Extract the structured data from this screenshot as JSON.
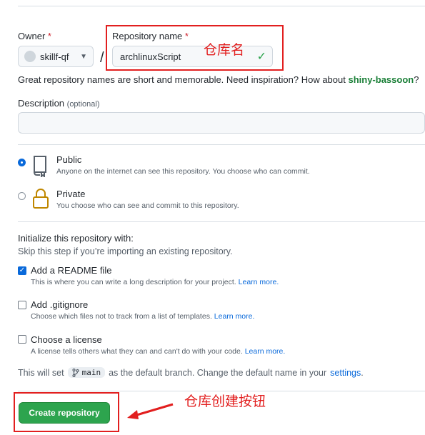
{
  "owner": {
    "label": "Owner",
    "required_mark": "*",
    "value": "skillf-qf"
  },
  "repo_name": {
    "label": "Repository name",
    "required_mark": "*",
    "value": "archlinuxScript",
    "valid_icon": "check-icon"
  },
  "annotations": {
    "repo_name_note": "仓库名",
    "create_button_note": "仓库创建按钮",
    "color": "#e21f1f"
  },
  "hint": {
    "prefix": "Great repository names are short and memorable. Need inspiration? How about ",
    "suggestion": "shiny-bassoon",
    "suffix": "?"
  },
  "description": {
    "label": "Description",
    "optional": "(optional)",
    "value": ""
  },
  "visibility": {
    "selected": "public",
    "public_title": "Public",
    "public_desc": "Anyone on the internet can see this repository. You choose who can commit.",
    "private_title": "Private",
    "private_desc": "You choose who can see and commit to this repository."
  },
  "init": {
    "heading": "Initialize this repository with:",
    "subheading": "Skip this step if you’re importing an existing repository.",
    "readme_title": "Add a README file",
    "readme_desc": "This is where you can write a long description for your project.",
    "readme_checked": true,
    "gitignore_title": "Add .gitignore",
    "gitignore_desc": "Choose which files not to track from a list of templates.",
    "gitignore_checked": false,
    "license_title": "Choose a license",
    "license_desc": "A license tells others what they can and can't do with your code.",
    "license_checked": false,
    "learn_more": "Learn more."
  },
  "branch": {
    "prefix": "This will set",
    "name": "main",
    "suffix": "as the default branch. Change the default name in your",
    "settings_link": "settings",
    "end": "."
  },
  "create_button": {
    "label": "Create repository",
    "color": "#2da44e"
  }
}
